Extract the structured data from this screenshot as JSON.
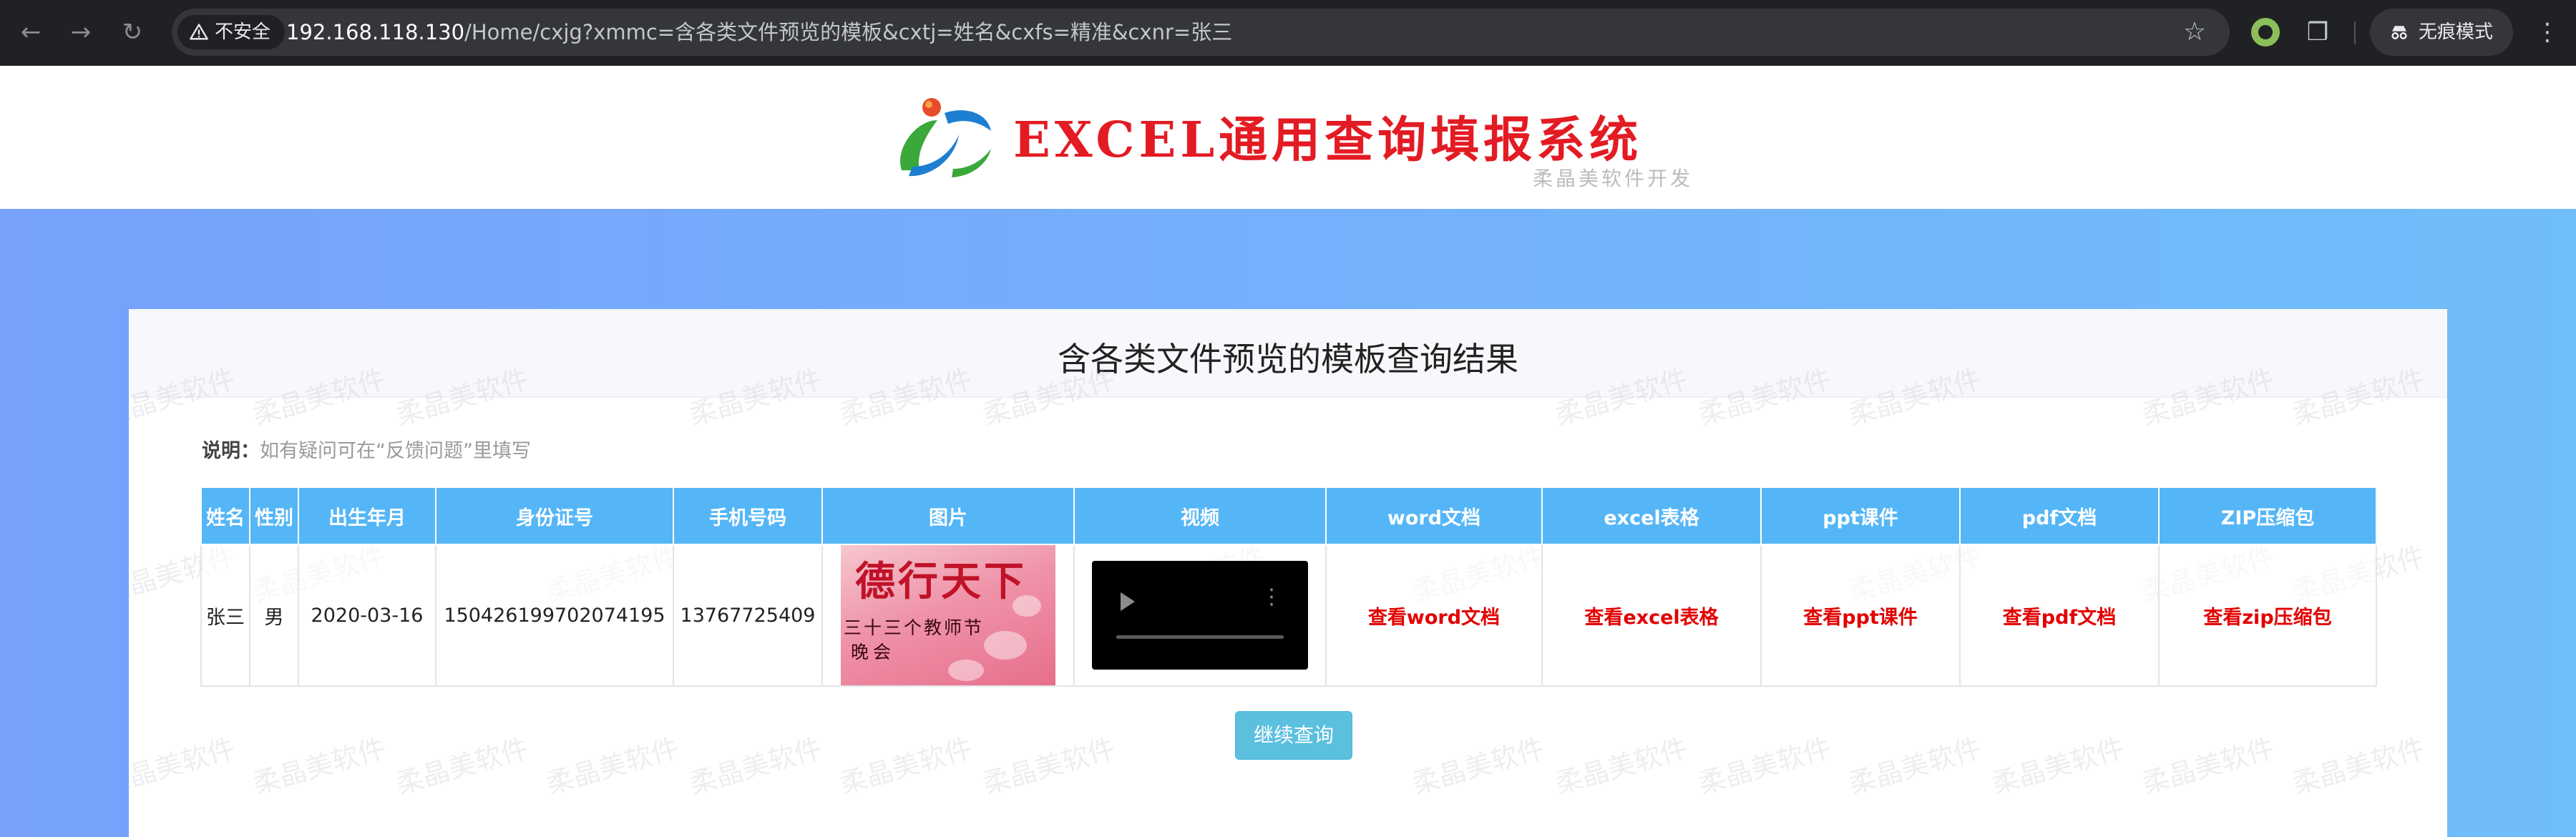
{
  "browser": {
    "security_label": "不安全",
    "url_host": "192.168.118.130",
    "url_rest": "/Home/cxjg?xmmc=含各类文件预览的模板&cxtj=姓名&cxfs=精准&cxnr=张三",
    "incognito_label": "无痕模式",
    "icons": {
      "back": "arrow-left-icon",
      "forward": "arrow-right-icon",
      "reload": "reload-icon",
      "warning": "warning-triangle-icon",
      "bookmark": "star-icon",
      "extension": "puzzle-icon",
      "incognito": "incognito-icon",
      "menu": "more-vertical-icon"
    }
  },
  "header": {
    "title": "EXCEL通用查询填报系统",
    "subtitle": "柔晶美软件开发"
  },
  "main": {
    "title": "含各类文件预览的模板查询结果",
    "note_label": "说明：",
    "note_text": "如有疑问可在“反馈问题”里填写",
    "watermark": "柔晶美软件",
    "continue_button": "继续查询"
  },
  "table": {
    "headers": [
      "姓名",
      "性别",
      "出生年月",
      "身份证号",
      "手机号码",
      "图片",
      "视频",
      "word文档",
      "excel表格",
      "ppt课件",
      "pdf文档",
      "ZIP压缩包"
    ],
    "row": {
      "name": "张三",
      "gender": "男",
      "birth": "2020-03-16",
      "id_number": "150426199702074195",
      "phone": "13767725409",
      "image_title": "德行天下",
      "image_line1": "三十三个教师节",
      "image_line2": "晚会",
      "word_link": "查看word文档",
      "excel_link": "查看excel表格",
      "ppt_link": "查看ppt课件",
      "pdf_link": "查看pdf文档",
      "zip_link": "查看zip压缩包"
    }
  },
  "colors": {
    "header_accent": "#e31b23",
    "table_header": "#55b6f7",
    "link": "#e30000",
    "button": "#5bc0de",
    "band_left": "#77a1fb",
    "band_right": "#6fbdf9"
  }
}
